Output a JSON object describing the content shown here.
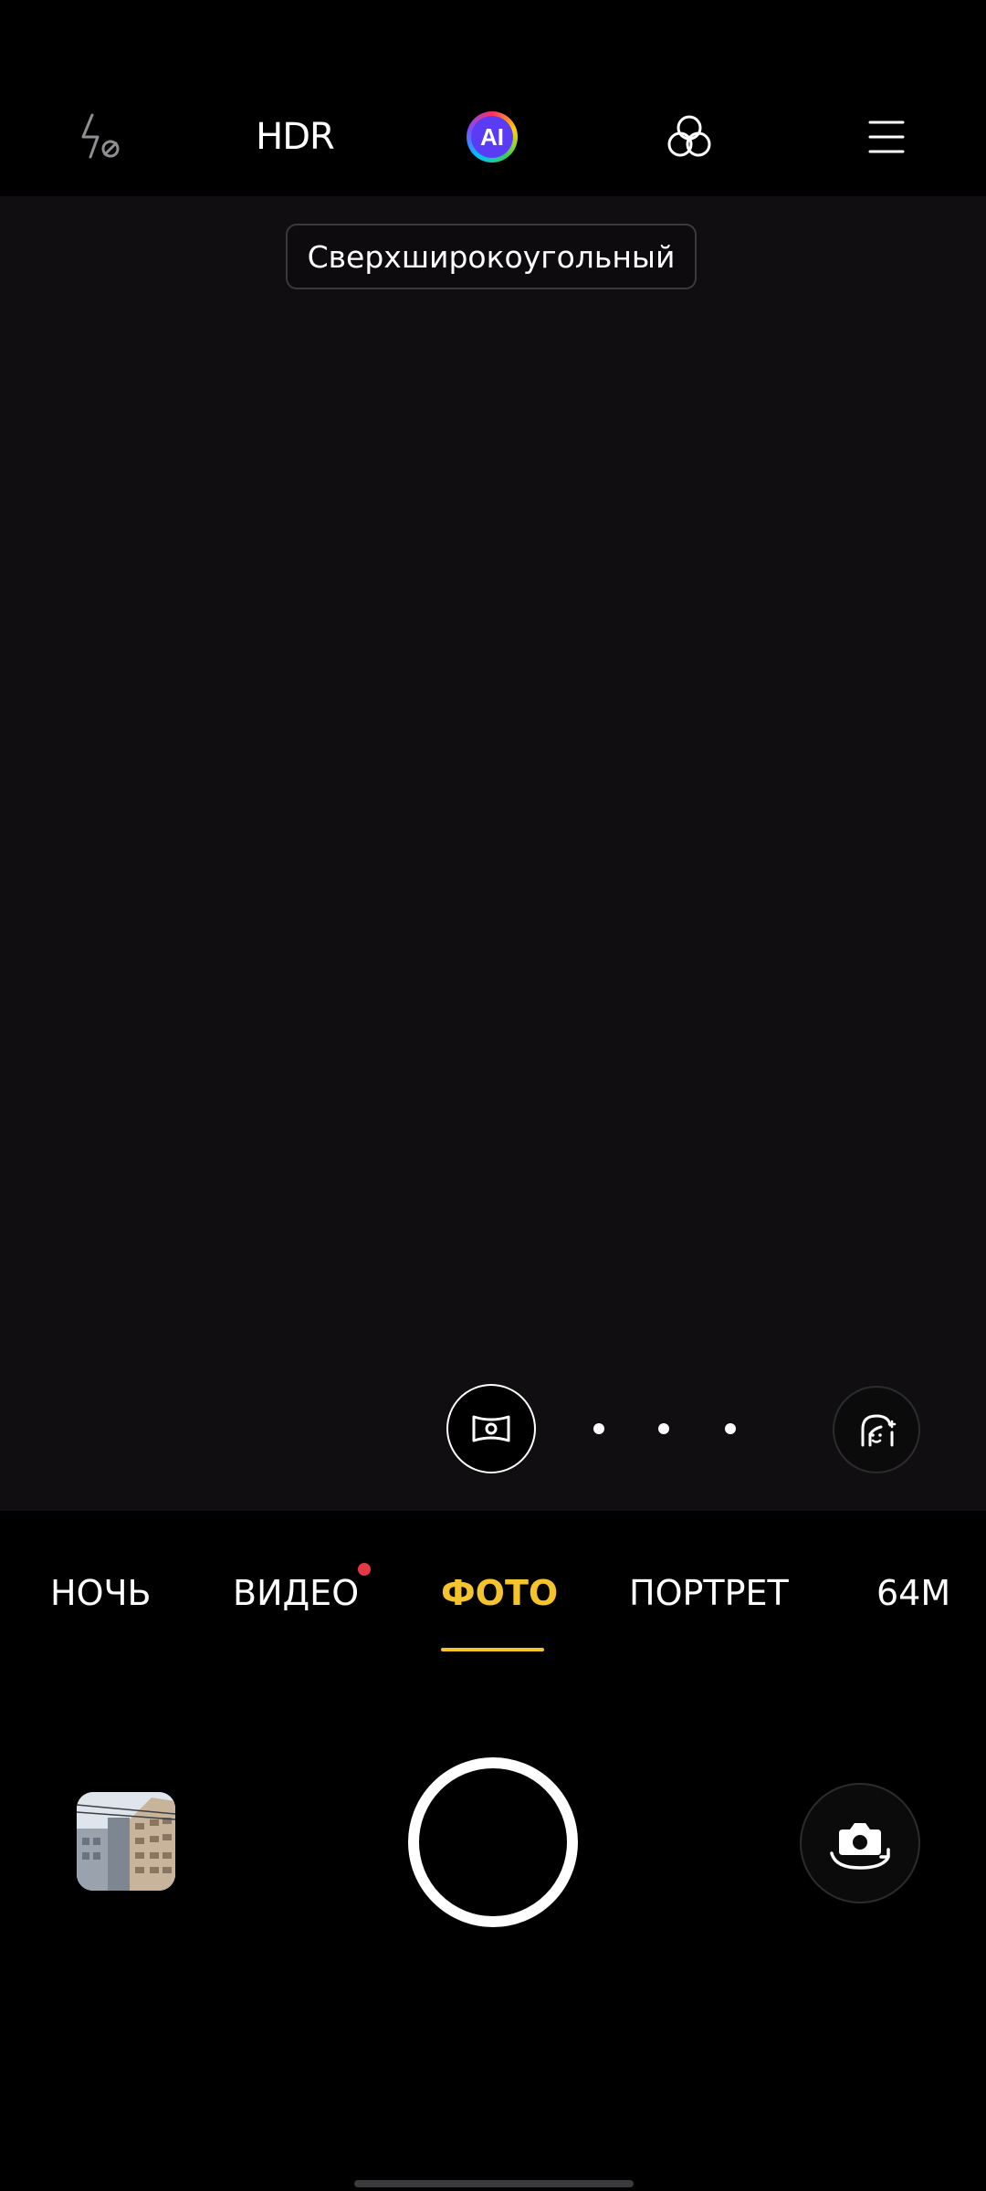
{
  "top_bar": {
    "flash_icon": "flash-off-icon",
    "hdr_label": "HDR",
    "ai_label": "AI",
    "filter_icon": "filter-icon",
    "menu_icon": "menu-icon"
  },
  "viewfinder": {
    "lens_label": "Сверхширокоугольный",
    "panorama_icon": "panorama-icon",
    "beauty_icon": "beauty-face-icon"
  },
  "modes": {
    "items": [
      {
        "label": "НОЧЬ"
      },
      {
        "label": "ВИДЕО"
      },
      {
        "label": "ФОТО"
      },
      {
        "label": "ПОРТРЕТ"
      },
      {
        "label": "64M"
      }
    ],
    "selected": "ФОТО",
    "new_indicator": "ВИДЕО"
  },
  "bottom": {
    "gallery_icon": "gallery-thumbnail",
    "shutter_icon": "shutter-button",
    "switch_icon": "switch-camera-icon"
  },
  "colors": {
    "accent": "#f5c42c",
    "viewfinder_bg": "#100e11",
    "notification_dot": "#e63946"
  }
}
